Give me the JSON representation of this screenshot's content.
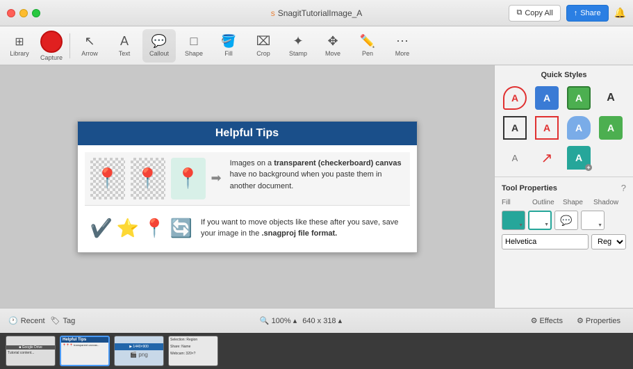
{
  "titlebar": {
    "title": "SnagitTutorialImage_A",
    "copy_all_label": "Copy All",
    "share_label": "Share"
  },
  "toolbar": {
    "library_label": "Library",
    "capture_label": "Capture",
    "arrow_label": "Arrow",
    "text_label": "Text",
    "callout_label": "Callout",
    "shape_label": "Shape",
    "fill_label": "Fill",
    "crop_label": "Crop",
    "stamp_label": "Stamp",
    "move_label": "Move",
    "pen_label": "Pen",
    "more_label": "More"
  },
  "quick_styles": {
    "title": "Quick Styles"
  },
  "tool_properties": {
    "title": "Tool Properties",
    "fill_label": "Fill",
    "outline_label": "Outline",
    "shape_label": "Shape",
    "shadow_label": "Shadow",
    "font_name": "Helvetica",
    "font_style": "Regular"
  },
  "statusbar": {
    "recent_label": "Recent",
    "tag_label": "Tag",
    "zoom_label": "100%",
    "zoom_arrow": "▴",
    "dims_label": "640 x 318",
    "dims_arrow": "▴",
    "effects_label": "Effects",
    "properties_label": "Properties"
  },
  "canvas": {
    "header": "Helpful Tips",
    "text1": "Images on a transparent (checkerboard) canvas have no background when you paste them in another document.",
    "text2": "If you want to move objects like these after you save, save your image in the .snagproj file format."
  }
}
